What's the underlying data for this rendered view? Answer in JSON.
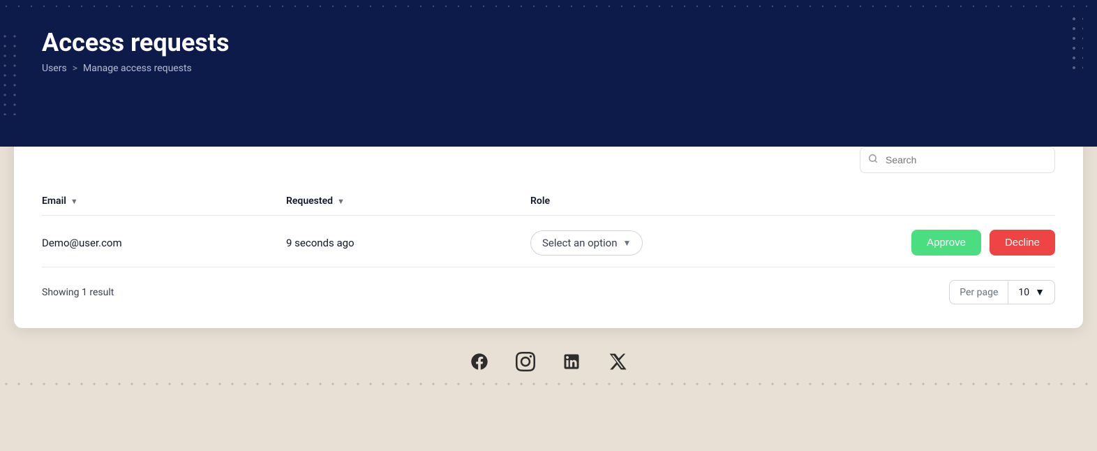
{
  "header": {
    "title": "Access requests",
    "breadcrumb": {
      "parent": "Users",
      "separator": ">",
      "current": "Manage access requests"
    }
  },
  "search": {
    "placeholder": "Search"
  },
  "table": {
    "columns": [
      {
        "key": "email",
        "label": "Email",
        "sortable": true
      },
      {
        "key": "requested",
        "label": "Requested",
        "sortable": true
      },
      {
        "key": "role",
        "label": "Role",
        "sortable": false
      }
    ],
    "rows": [
      {
        "email": "Demo@user.com",
        "requested": "9 seconds ago",
        "role_placeholder": "Select an option"
      }
    ]
  },
  "footer_row": {
    "showing_text": "Showing 1 result",
    "per_page_label": "Per page",
    "per_page_value": "10"
  },
  "actions": {
    "approve_label": "Approve",
    "decline_label": "Decline"
  },
  "social": {
    "icons": [
      "facebook",
      "instagram",
      "linkedin",
      "x-twitter"
    ]
  }
}
